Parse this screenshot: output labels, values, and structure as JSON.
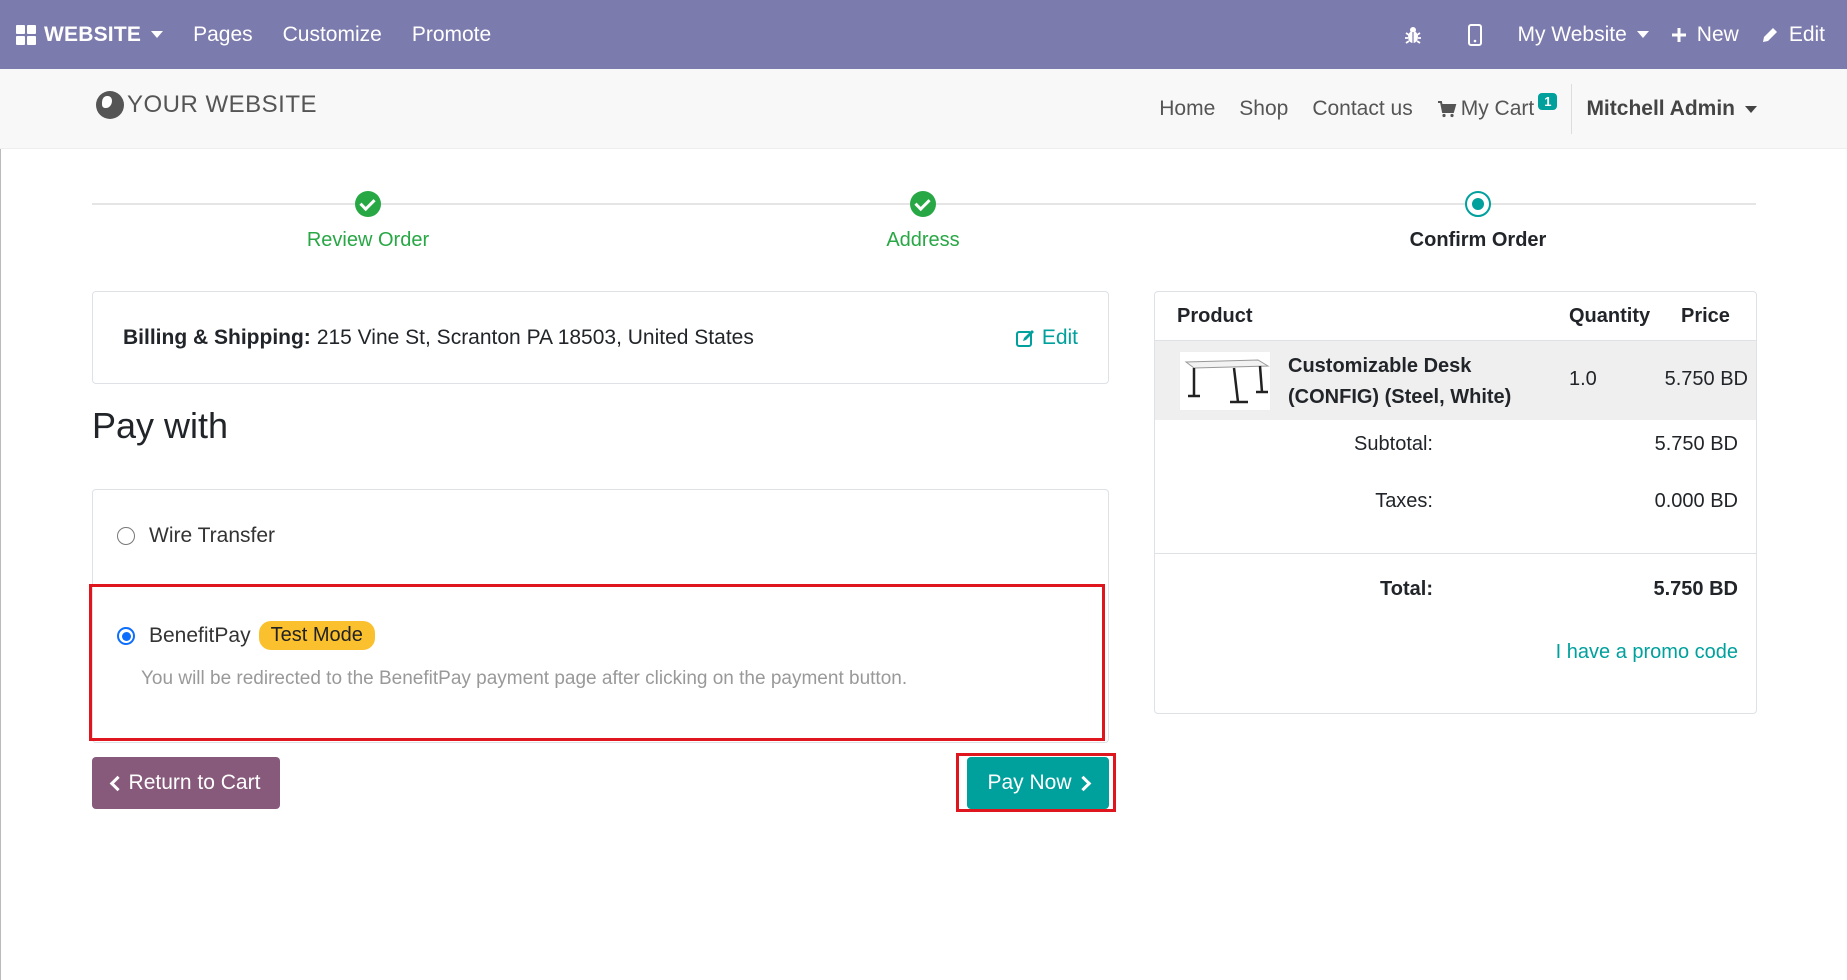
{
  "adminbar": {
    "brand": "WEBSITE",
    "menu": [
      "Pages",
      "Customize",
      "Promote"
    ],
    "website_selector": "My Website",
    "new_label": "New",
    "edit_label": "Edit"
  },
  "site": {
    "logo": "YOUR WEBSITE",
    "nav": [
      "Home",
      "Shop",
      "Contact us"
    ],
    "cart_label": "My Cart",
    "cart_count": "1",
    "user": "Mitchell Admin"
  },
  "wizard": {
    "steps": [
      {
        "label": "Review Order",
        "state": "done"
      },
      {
        "label": "Address",
        "state": "done"
      },
      {
        "label": "Confirm Order",
        "state": "current"
      }
    ]
  },
  "billing": {
    "label": "Billing & Shipping:",
    "address": "215 Vine St, Scranton PA 18503, United States",
    "edit_label": "Edit"
  },
  "payment": {
    "heading": "Pay with",
    "options": [
      {
        "label": "Wire Transfer",
        "selected": false
      },
      {
        "label": "BenefitPay",
        "selected": true,
        "badge": "Test Mode",
        "help": "You will be redirected to the BenefitPay payment page after clicking on the payment button."
      }
    ]
  },
  "buttons": {
    "return_label": "Return to Cart",
    "pay_label": "Pay Now"
  },
  "summary": {
    "headers": {
      "product": "Product",
      "quantity": "Quantity",
      "price": "Price"
    },
    "lines": [
      {
        "name": "Customizable Desk (CONFIG) (Steel, White)",
        "quantity": "1.0",
        "price": "5.750 BD"
      }
    ],
    "subtotal_label": "Subtotal:",
    "subtotal": "5.750 BD",
    "taxes_label": "Taxes:",
    "taxes": "0.000 BD",
    "total_label": "Total:",
    "total": "5.750 BD",
    "promo_label": "I have a promo code"
  },
  "colors": {
    "adminbar": "#7c7bad",
    "primary": "#00a09d",
    "secondary": "#875a7b",
    "success": "#28a745",
    "highlight": "#e0161e",
    "badge_warning": "#fbc02d"
  }
}
